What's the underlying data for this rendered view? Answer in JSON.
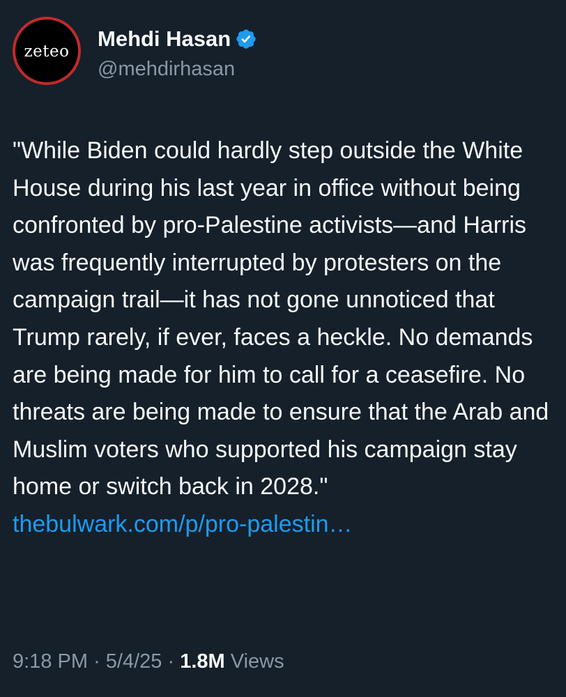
{
  "author": {
    "display_name": "Mehdi Hasan",
    "handle": "@mehdirhasan",
    "avatar_text": "zeteo",
    "verified": true,
    "verified_icon": "verified-badge-icon",
    "verified_color": "#1d9bf0",
    "avatar_ring_color": "#c22a2a"
  },
  "tweet": {
    "text": "\"While Biden could hardly step outside the White House during his last year in office without being confronted by pro-Palestine activists—and Harris was frequently interrupted by protesters on the campaign trail—it has not gone unnoticed that Trump rarely, if ever, faces a heckle. No demands are being made for him to call for a ceasefire. No threats are being made to ensure that the Arab and Muslim voters who supported his campaign stay home or switch back in 2028.\"",
    "link_text": "thebulwark.com/p/pro-palestin…",
    "link_color": "#1d9bf0"
  },
  "meta": {
    "time": "9:18 PM",
    "separator": "·",
    "date": "5/4/25",
    "views_count": "1.8M",
    "views_label": "Views"
  },
  "theme": {
    "background": "#15202b",
    "text": "#f7f9f9",
    "secondary_text": "#8b98a5"
  }
}
